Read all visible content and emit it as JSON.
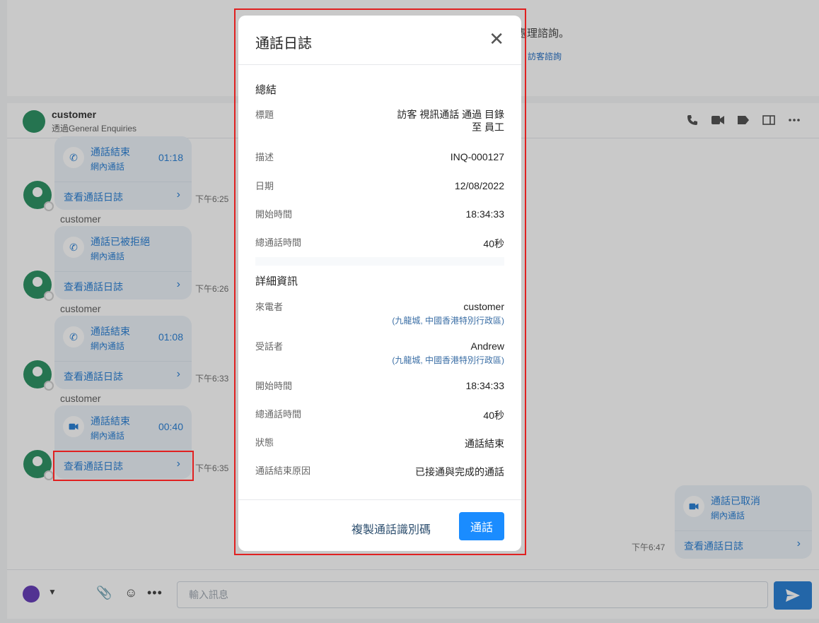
{
  "top": {
    "text": "處理諮詢。",
    "link": "訪客諮詢"
  },
  "chat_header": {
    "name": "customer",
    "sub": "透過General Enquiries"
  },
  "messages": [
    {
      "sender": "",
      "title": "通話結束",
      "sub": "網內通話",
      "duration": "01:18",
      "link": "查看通話日誌",
      "time": "下午6:25"
    },
    {
      "sender": "customer",
      "title": "通話已被拒絕",
      "sub": "網內通話",
      "duration": "",
      "link": "查看通話日誌",
      "time": "下午6:26"
    },
    {
      "sender": "customer",
      "title": "通話結束",
      "sub": "網內通話",
      "duration": "01:08",
      "link": "查看通話日誌",
      "time": "下午6:33"
    },
    {
      "sender": "customer",
      "title": "通話結束",
      "sub": "網內通話",
      "duration": "00:40",
      "link": "查看通話日誌",
      "time": "下午6:35"
    }
  ],
  "right_card": {
    "title": "通話已取消",
    "sub": "網內通話",
    "link": "查看通話日誌",
    "time": "下午6:47"
  },
  "composer": {
    "placeholder": "輸入訊息"
  },
  "modal": {
    "title": "通話日誌",
    "summary_title": "總結",
    "summary": [
      {
        "label": "標題",
        "value": "訪客 視訊通話 通過 目錄\n至 員工"
      },
      {
        "label": "描述",
        "value": "INQ-000127"
      },
      {
        "label": "日期",
        "value": "12/08/2022"
      },
      {
        "label": "開始時間",
        "value": "18:34:33"
      },
      {
        "label": "總通話時間",
        "value": "40秒"
      }
    ],
    "details_title": "詳細資訊",
    "details": [
      {
        "label": "來電者",
        "value": "customer",
        "sub": "(九龍城, 中國香港特別行政區)"
      },
      {
        "label": "受話者",
        "value": "Andrew",
        "sub": "(九龍城, 中國香港特別行政區)"
      },
      {
        "label": "開始時間",
        "value": "18:34:33"
      },
      {
        "label": "總通話時間",
        "value": "40秒"
      },
      {
        "label": "狀態",
        "value": "通話結束"
      },
      {
        "label": "通話結束原因",
        "value": "已接通與完成的通話"
      }
    ],
    "copy_label": "複製通話識別碼",
    "call_label": "通話"
  }
}
